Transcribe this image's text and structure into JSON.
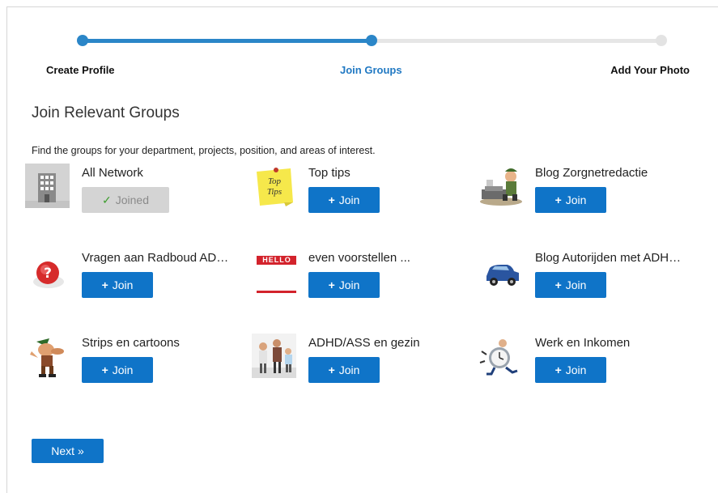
{
  "steps": {
    "step1": "Create Profile",
    "step2": "Join Groups",
    "step3": "Add Your Photo",
    "current": 2
  },
  "heading": "Join Relevant Groups",
  "intro": "Find the groups for your department, projects, position, and areas of interest.",
  "groups": [
    {
      "name": "All Network",
      "button": "Joined",
      "joined": true,
      "icon": "building-icon"
    },
    {
      "name": "Top tips",
      "button": "Join",
      "joined": false,
      "icon": "sticky-note-icon",
      "icon_text": "Top Tips"
    },
    {
      "name": "Blog Zorgnetredactie",
      "button": "Join",
      "joined": false,
      "icon": "newsroom-cartoon-icon"
    },
    {
      "name": "Vragen aan Radboud AD…",
      "button": "Join",
      "joined": false,
      "icon": "question-mark-icon"
    },
    {
      "name": "even voorstellen ...",
      "button": "Join",
      "joined": false,
      "icon": "hello-name-tag-icon",
      "icon_text": "HELLO"
    },
    {
      "name": "Blog Autorijden met ADH…",
      "button": "Join",
      "joined": false,
      "icon": "car-icon"
    },
    {
      "name": "Strips en cartoons",
      "button": "Join",
      "joined": false,
      "icon": "cartoon-character-icon"
    },
    {
      "name": "ADHD/ASS en gezin",
      "button": "Join",
      "joined": false,
      "icon": "family-photo-icon"
    },
    {
      "name": "Werk en Inkomen",
      "button": "Join",
      "joined": false,
      "icon": "running-clock-icon"
    }
  ],
  "next_button": "Next »",
  "colors": {
    "primary": "#0f74c8",
    "progress": "#2b86c8",
    "active_step": "#2179c3",
    "joined_bg": "#d4d4d4",
    "check": "#3e9e2f"
  }
}
